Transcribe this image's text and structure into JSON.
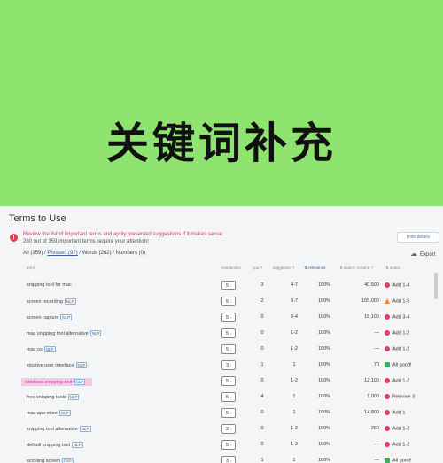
{
  "banner": {
    "title": "关键词补充"
  },
  "panel": {
    "title": "Terms to Use",
    "alert": {
      "line1": "Review the list of important terms and apply presented suggestions if it makes sense.",
      "line2": "260 out of 359 important terms require your attention!"
    },
    "hide_details": "Hide details",
    "filters": {
      "all": "All (359)",
      "sep1": " / ",
      "phrases": "Phrases (97)",
      "sep2": " / ",
      "words": "Words (262)",
      "sep3": " / ",
      "numbers": "Numbers (0)"
    },
    "export_label": "Export"
  },
  "columns": {
    "term": "term",
    "evenbooks": "evenbooks",
    "you": "you ?",
    "suggested": "suggested ?",
    "relevance": "relevance",
    "search_volume": "search volume ?",
    "action": "action"
  },
  "rows": [
    {
      "term": "snipping tool for mac",
      "nlp": false,
      "ev": "5",
      "you": "3",
      "sug": "4-7",
      "rel": "100%",
      "vol": "40,500",
      "act": "Add 1-4",
      "act_type": "red"
    },
    {
      "term": "screen recording",
      "nlp": true,
      "ev": "5",
      "you": "2",
      "sug": "3-7",
      "rel": "100%",
      "vol": "165,000",
      "act": "Add 1-5",
      "act_type": "orange"
    },
    {
      "term": "screen capture",
      "nlp": true,
      "ev": "5",
      "you": "0",
      "sug": "3-4",
      "rel": "100%",
      "vol": "18,100",
      "act": "Add 3-4",
      "act_type": "red"
    },
    {
      "term": "mac snipping tool alternative",
      "nlp": true,
      "ev": "5",
      "you": "0",
      "sug": "1-2",
      "rel": "100%",
      "vol": "—",
      "act": "Add 1-2",
      "act_type": "red"
    },
    {
      "term": "mac os",
      "nlp": true,
      "ev": "5",
      "you": "0",
      "sug": "1-2",
      "rel": "100%",
      "vol": "—",
      "act": "Add 1-2",
      "act_type": "red"
    },
    {
      "term": "intuitive user interface",
      "nlp": true,
      "ev": "3",
      "you": "1",
      "sug": "1",
      "rel": "100%",
      "vol": "70",
      "act": "All good!",
      "act_type": "green"
    },
    {
      "term": "windows snipping tool",
      "nlp": true,
      "ev": "5",
      "you": "0",
      "sug": "1-2",
      "rel": "100%",
      "vol": "12,100",
      "act": "Add 1-2",
      "act_type": "red",
      "highlight": true
    },
    {
      "term": "free snipping tools",
      "nlp": true,
      "ev": "5",
      "you": "4",
      "sug": "1",
      "rel": "100%",
      "vol": "1,000",
      "act": "Remove 3",
      "act_type": "red"
    },
    {
      "term": "mac app store",
      "nlp": true,
      "ev": "5",
      "you": "0",
      "sug": "1",
      "rel": "100%",
      "vol": "14,800",
      "act": "Add 1",
      "act_type": "red"
    },
    {
      "term": "snipping tool alternative",
      "nlp": true,
      "ev": "2",
      "you": "0",
      "sug": "1-2",
      "rel": "100%",
      "vol": "260",
      "act": "Add 1-2",
      "act_type": "red"
    },
    {
      "term": "default snipping tool",
      "nlp": true,
      "ev": "5",
      "you": "0",
      "sug": "1-2",
      "rel": "100%",
      "vol": "—",
      "act": "Add 1-2",
      "act_type": "red"
    },
    {
      "term": "scrolling screen",
      "nlp": true,
      "ev": "3",
      "you": "1",
      "sug": "1",
      "rel": "100%",
      "vol": "—",
      "act": "All good!",
      "act_type": "green"
    }
  ],
  "colors": {
    "banner": "#8ee46f",
    "alert": "#e0405a",
    "link": "#3b5e96",
    "highlight": "#f6c9e6",
    "good": "#3fae5c",
    "warn": "#f08a3c"
  }
}
